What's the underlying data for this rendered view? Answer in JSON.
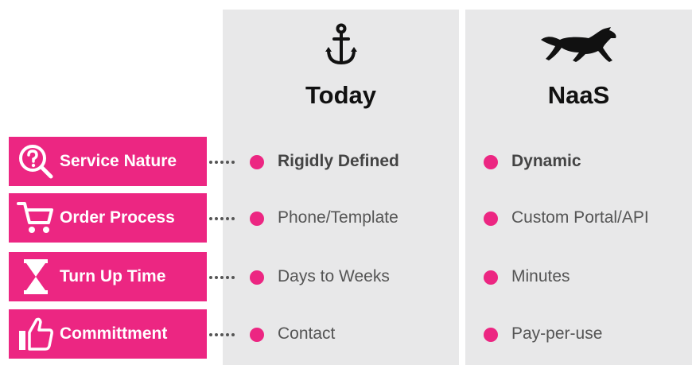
{
  "columns": {
    "today": {
      "title": "Today",
      "icon": "anchor-icon"
    },
    "naas": {
      "title": "NaaS",
      "icon": "horse-icon"
    }
  },
  "rows": [
    {
      "label": "Service Nature",
      "icon": "question-search-icon",
      "today": "Rigidly Defined",
      "naas": "Dynamic"
    },
    {
      "label": "Order Process",
      "icon": "shopping-cart-icon",
      "today": "Phone/Template",
      "naas": "Custom Portal/API"
    },
    {
      "label": "Turn Up Time",
      "icon": "hourglass-icon",
      "today": "Days to Weeks",
      "naas": "Minutes"
    },
    {
      "label": "Committment",
      "icon": "thumbs-up-icon",
      "today": "Contact",
      "naas": "Pay-per-use"
    }
  ],
  "colors": {
    "accent": "#ec2682",
    "column_bg": "#e8e8e9"
  }
}
